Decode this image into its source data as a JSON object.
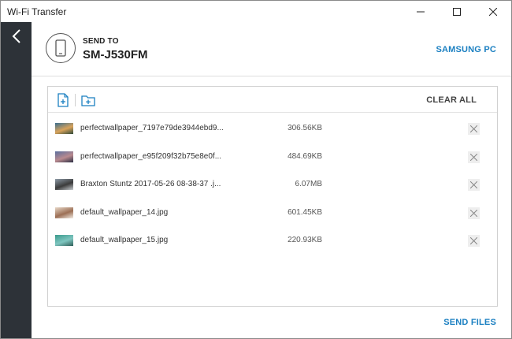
{
  "window": {
    "title": "Wi-Fi Transfer"
  },
  "header": {
    "send_to_label": "SEND TO",
    "device_name": "SM-J530FM",
    "target_pc": "SAMSUNG PC"
  },
  "toolbar": {
    "clear_all_label": "CLEAR ALL"
  },
  "files": [
    {
      "name": "perfectwallpaper_7197e79de3944ebd9...",
      "size": "306.56KB",
      "thumb_colors": [
        "#3a6e8f",
        "#d9a35b",
        "#2f4a3a"
      ]
    },
    {
      "name": "perfectwallpaper_e95f209f32b75e8e0f...",
      "size": "484.69KB",
      "thumb_colors": [
        "#5b6f9e",
        "#b98a8f",
        "#2c2f44"
      ]
    },
    {
      "name": "Braxton Stuntz  2017-05-26 08-38-37 .j...",
      "size": "6.07MB",
      "thumb_colors": [
        "#8d9aa6",
        "#3b3b3b",
        "#c9ced2"
      ]
    },
    {
      "name": "default_wallpaper_14.jpg",
      "size": "601.45KB",
      "thumb_colors": [
        "#e8d8c8",
        "#9c6f55",
        "#f2ece4"
      ]
    },
    {
      "name": "default_wallpaper_15.jpg",
      "size": "220.93KB",
      "thumb_colors": [
        "#3a9a8c",
        "#7fc6c0",
        "#2f5e58"
      ]
    }
  ],
  "footer": {
    "send_files_label": "SEND FILES"
  },
  "colors": {
    "accent": "#1a7fc1",
    "sidebar": "#2d3238"
  }
}
